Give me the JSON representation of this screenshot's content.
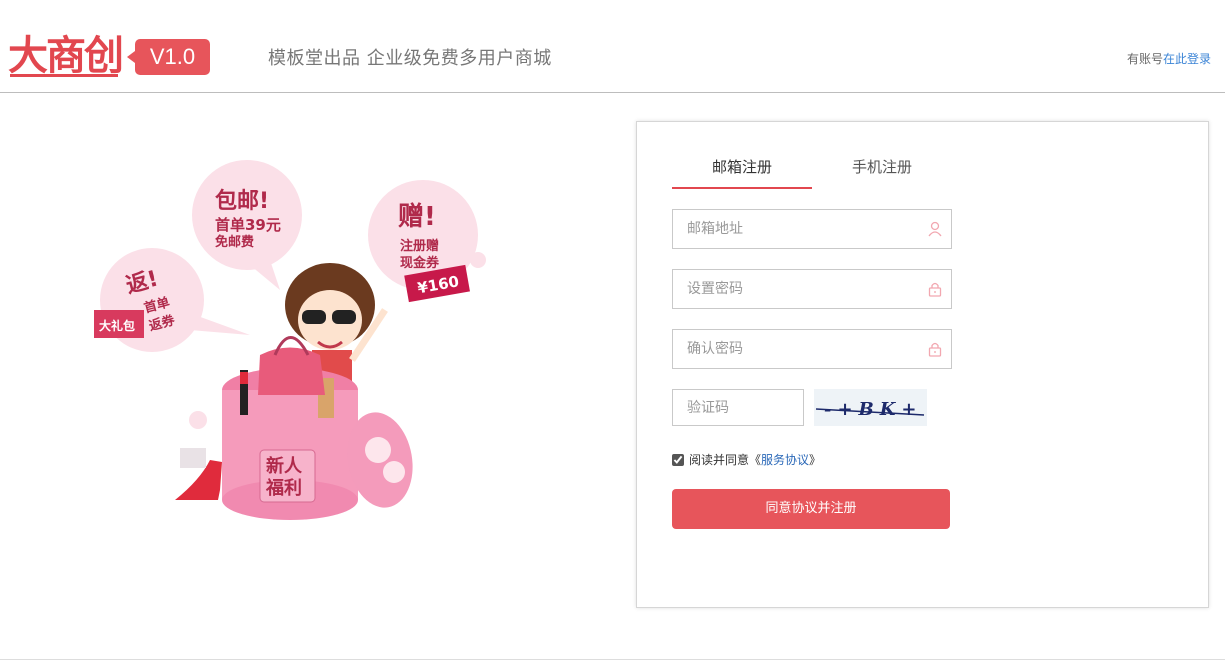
{
  "header": {
    "logo_text": "大商创",
    "version": "V1.0",
    "slogan": "模板堂出品  企业级免费多用户商城",
    "login_prefix": "有账号",
    "login_link": "在此登录"
  },
  "illustration": {
    "bubble_postage_title": "包邮!",
    "bubble_postage_line1": "首单39元",
    "bubble_postage_line2": "免邮费",
    "bubble_gift_title": "赠!",
    "bubble_gift_line1": "注册赠",
    "bubble_gift_line2": "现金券",
    "bubble_gift_tag": "¥160",
    "bubble_return_title": "返!",
    "bubble_return_line1": "首单",
    "bubble_return_line2": "返券",
    "bubble_return_tag": "大礼包",
    "box_label_line1": "新人",
    "box_label_line2": "福利"
  },
  "form": {
    "tabs": [
      {
        "label": "邮箱注册",
        "active": true
      },
      {
        "label": "手机注册",
        "active": false
      }
    ],
    "email_placeholder": "邮箱地址",
    "password_placeholder": "设置密码",
    "confirm_placeholder": "确认密码",
    "captcha_placeholder": "验证码",
    "captcha_image_text": "-+BK+",
    "agree_text": "阅读并同意",
    "agree_link": "服务协议",
    "agree_checked": true,
    "submit_label": "同意协议并注册"
  },
  "colors": {
    "brand": "#e2474f",
    "button": "#e7555b",
    "link": "#3b84d6"
  }
}
